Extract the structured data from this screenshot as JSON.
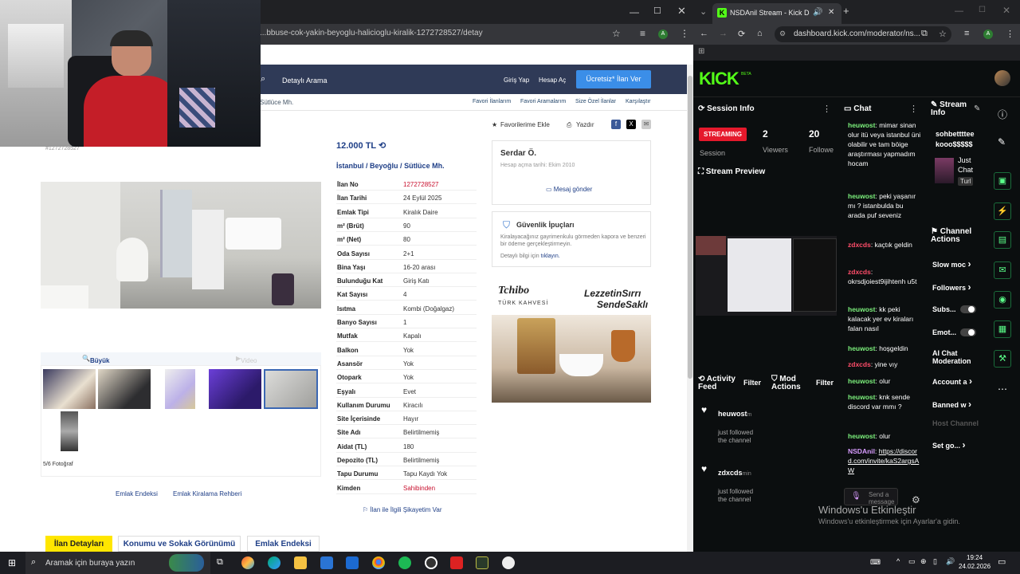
{
  "left_browser": {
    "url": "...bbuse-cok-yakin-beyoglu-halicioglu-kiralik-1272728527/detay",
    "header": {
      "search_placeholder": "Detaylı Arama",
      "login": "Giriş Yap",
      "register": "Hesap Aç",
      "cta": "Ücretsiz* İlan Ver"
    },
    "breadcrumb_tail": "Sütlüce Mh.",
    "top_links": [
      "Favori İlanlarım",
      "Favori Aramalarım",
      "Size Özel İlanlar",
      "Karşılaştır"
    ],
    "actions": {
      "favorite": "Favorilerime Ekle",
      "print": "Yazdır"
    },
    "listing_id_small": "#1272728527",
    "price": "12.000 TL",
    "location": [
      "İstanbul",
      "Beyoğlu",
      "Sütlüce Mh."
    ],
    "details": [
      {
        "k": "İlan No",
        "v": "1272728527"
      },
      {
        "k": "İlan Tarihi",
        "v": "24 Eylül 2025"
      },
      {
        "k": "Emlak Tipi",
        "v": "Kiralık Daire"
      },
      {
        "k": "m² (Brüt)",
        "v": "90"
      },
      {
        "k": "m² (Net)",
        "v": "80"
      },
      {
        "k": "Oda Sayısı",
        "v": "2+1"
      },
      {
        "k": "Bina Yaşı",
        "v": "16-20 arası"
      },
      {
        "k": "Bulunduğu Kat",
        "v": "Giriş Katı"
      },
      {
        "k": "Kat Sayısı",
        "v": "4"
      },
      {
        "k": "Isıtma",
        "v": "Kombi (Doğalgaz)"
      },
      {
        "k": "Banyo Sayısı",
        "v": "1"
      },
      {
        "k": "Mutfak",
        "v": "Kapalı"
      },
      {
        "k": "Balkon",
        "v": "Yok"
      },
      {
        "k": "Asansör",
        "v": "Yok"
      },
      {
        "k": "Otopark",
        "v": "Yok"
      },
      {
        "k": "Eşyalı",
        "v": "Evet"
      },
      {
        "k": "Kullanım Durumu",
        "v": "Kiracılı"
      },
      {
        "k": "Site İçerisinde",
        "v": "Hayır"
      },
      {
        "k": "Site Adı",
        "v": "Belirtilmemiş"
      },
      {
        "k": "Aidat (TL)",
        "v": "180"
      },
      {
        "k": "Depozito (TL)",
        "v": "Belirtilmemiş"
      },
      {
        "k": "Tapu Durumu",
        "v": "Tapu Kaydı Yok"
      },
      {
        "k": "Kimden",
        "v": "Sahibinden"
      }
    ],
    "report_link": "İlan ile İlgili Şikayetim Var",
    "photo_tabs": {
      "big_photo": "Büyük Fotoğraf",
      "video": "Video"
    },
    "photo_count": "5/6 Fotoğraf",
    "footer_links": [
      "Emlak Endeksi",
      "Emlak Kiralama Rehberi"
    ],
    "seller": {
      "name": "Serdar Ö.",
      "since": "Hesap açma tarihi: Ekim 2010",
      "message": "Mesaj gönder"
    },
    "safety": {
      "title": "Güvenlik İpuçları",
      "text": "Kiralayacağınız gayrimenkulu görmeden kapora ve benzeri bir ödeme gerçekleştirmeyin.",
      "more": "Detaylı bilgi için",
      "more_link": "tıklayın."
    },
    "ad": {
      "brand": "Tchibo",
      "brand_sub": "TÜRK KAHVESİ",
      "slogan1": "LezzetinSırrı",
      "slogan2": "SendeSaklı"
    },
    "page_tabs": [
      "İlan Detayları",
      "Konumu ve Sokak Görünümü",
      "Emlak Endeksi"
    ]
  },
  "right_browser": {
    "tab_title": "NSDAnil Stream - Kick Dash",
    "url": "dashboard.kick.com/moderator/ns...",
    "logo": "KICK",
    "logo_badge": "BETA",
    "session": {
      "title": "Session Info",
      "status": "STREAMING",
      "session_label": "Session",
      "viewers_value": "2",
      "viewers_label": "Viewers",
      "followers_value": "20",
      "followers_label": "Followe"
    },
    "stream_preview": "Stream Preview",
    "chat": {
      "title": "Chat",
      "messages": [
        {
          "user": "heuwost",
          "text": "mimar sinan olur itü veya istanbul üni olabilir ve tam böige araştırması yapmadım hocam"
        },
        {
          "user": "heuwost",
          "text": "peki yaşanır mı ? istanbulda bu arada puf seveniz"
        },
        {
          "user": "zdxcds",
          "text": "kaçtık geldin"
        },
        {
          "user": "zdxcds",
          "text": "okrsdjoiest9ijihtenh u5t"
        },
        {
          "user": "heuwost",
          "text": "kk peki kalacak yer ev kiraları falan nasıl"
        },
        {
          "user": "heuwost",
          "text": "hoşgeldin"
        },
        {
          "user": "zdxcds",
          "text": "yine vıy"
        },
        {
          "user": "heuwost",
          "text": "olur"
        },
        {
          "user": "heuwost",
          "text": "knk sende discord var mmı ?"
        },
        {
          "user": "heuwost",
          "text": "olur"
        },
        {
          "user": "NSDAnil",
          "text": "https://discord.com/invite/kaS2argsAW"
        }
      ],
      "send_placeholder": "Send a message"
    },
    "stream_info": {
      "title": "Stream Info",
      "line1": "sohbettttee",
      "line2": "kooo$$$$$",
      "tag": "Just Chat",
      "tag2": "Turl"
    },
    "channel_actions": {
      "title": "Channel Actions",
      "items": [
        "Slow moc",
        "Followers",
        "Subs...",
        "Emot...",
        "AI Chat Moderation",
        "Account a",
        "Banned w",
        "Host Channel",
        "Set go..."
      ]
    },
    "activity_feed": {
      "title": "Activity Feed",
      "filter": "Filter",
      "items": [
        {
          "user": "heuwost",
          "suffix": "m",
          "text": "just followed the channel"
        },
        {
          "user": "zdxcds",
          "suffix": "min",
          "text": "just followed the channel"
        }
      ]
    },
    "mod_actions": {
      "title": "Mod Actions",
      "filter": "Filter"
    }
  },
  "watermark": {
    "line1": "Windows'u Etkinleştir",
    "line2": "Windows'u etkinleştirmek için Ayarlar'a gidin."
  },
  "taskbar": {
    "search": "Aramak için buraya yazın",
    "time": "19:24",
    "date": "24.02.2026"
  }
}
